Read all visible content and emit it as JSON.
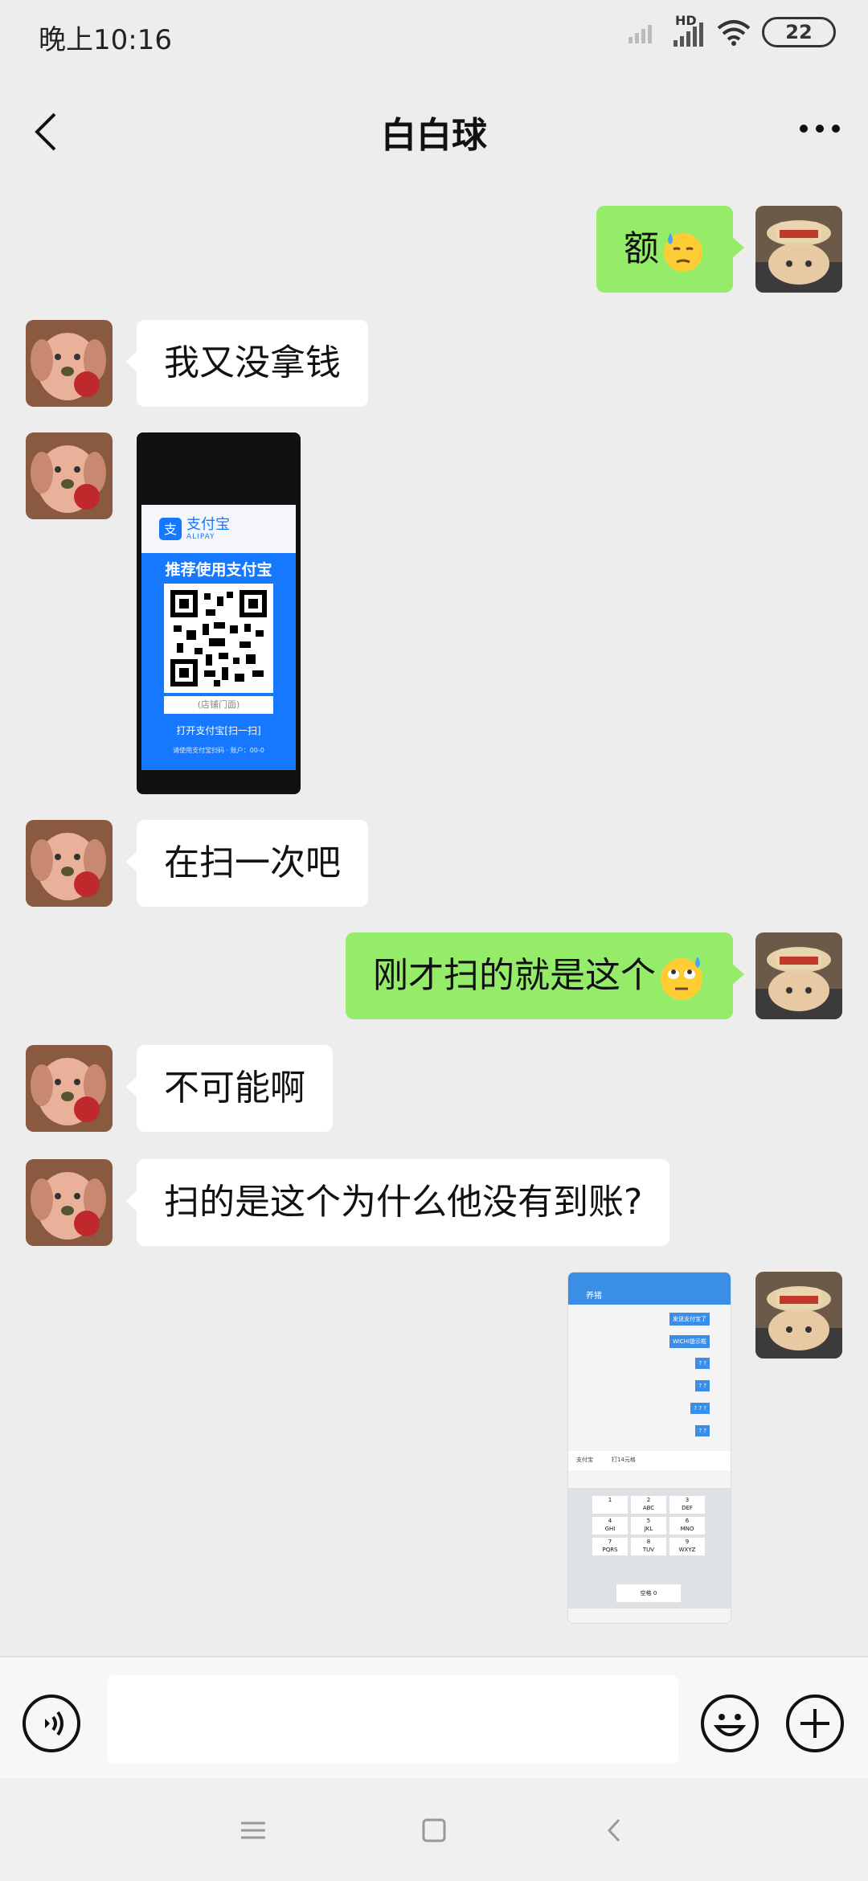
{
  "status_bar": {
    "time": "晚上10:16",
    "network": "HD",
    "battery": "22"
  },
  "header": {
    "title": "白白球"
  },
  "messages": [
    {
      "side": "right",
      "type": "text",
      "text": "额",
      "emoji": "downcast-sweat-face"
    },
    {
      "side": "left",
      "type": "text",
      "text": "我又没拿钱"
    },
    {
      "side": "left",
      "type": "image",
      "image": {
        "brand": "支付宝",
        "brand_en": "ALIPAY",
        "banner": "推荐使用支付宝",
        "caption_top": "(店铺门面)",
        "caption": "打开支付宝[扫一扫]",
        "caption_bottom": "请使用支付宝扫码 · 账户：00-0"
      }
    },
    {
      "side": "left",
      "type": "text",
      "text": "在扫一次吧"
    },
    {
      "side": "right",
      "type": "text",
      "text": "刚才扫的就是这个",
      "emoji": "rolling-eyes-sweat-face"
    },
    {
      "side": "left",
      "type": "text",
      "text": "不可能啊"
    },
    {
      "side": "left",
      "type": "text",
      "text": "扫的是这个为什么他没有到账?"
    },
    {
      "side": "right",
      "type": "image",
      "image": {
        "title": "养猪",
        "chat_lines": [
          "发送支付宝了",
          "WiCHI提示框",
          "? ?",
          "? ?",
          "? ? ?",
          "? ?"
        ],
        "toolbar": [
          "支付宝",
          "打14元格"
        ],
        "keys": [
          "1",
          "2\nABC",
          "3\nDEF",
          "4\nGHI",
          "5\nJKL",
          "6\nMNO",
          "7\nPQRS",
          "8\nTUV",
          "9\nWXYZ",
          "空格 0"
        ]
      }
    }
  ],
  "input_bar": {
    "placeholder": ""
  },
  "colors": {
    "green_bubble": "#95ec69",
    "white_bubble": "#ffffff",
    "background": "#ededed",
    "alipay_blue": "#1677ff"
  }
}
